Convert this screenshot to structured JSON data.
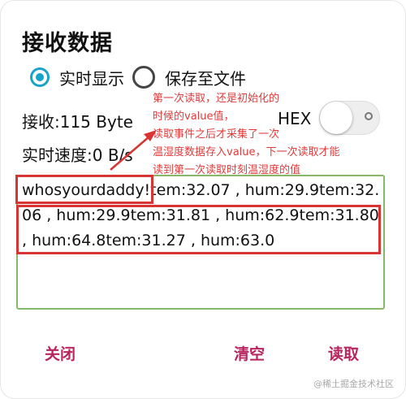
{
  "dialog": {
    "title": "接收数据"
  },
  "display_mode": {
    "realtime_label": "实时显示",
    "save_label": "保存至文件",
    "selected": "realtime"
  },
  "stats": {
    "received": "接收:115 Byte",
    "speed": "实时速度:0 B/s",
    "hex_label": "HEX",
    "hex_enabled": false
  },
  "received_data": "whosyourdaddy!tem:32.07 , hum:29.9tem:32.06 , hum:29.9tem:31.81 , hum:62.9tem:31.80 , hum:64.8tem:31.27 , hum:63.0",
  "annotation": {
    "lines": [
      "第一次读取，还是初始化的",
      "时候的value值，",
      "读取事件之后才采集了一次",
      "温湿度数据存入value，下一次读取才能",
      "读到第一次读取时刻温湿度的值"
    ],
    "color": "#e23a3a"
  },
  "buttons": {
    "close": "关闭",
    "clear": "清空",
    "read": "读取"
  },
  "colors": {
    "accent": "#1aa3c9",
    "button_text": "#b8245e",
    "data_border": "#86b86a",
    "highlight": "#d93434"
  },
  "watermark": "@稀土掘金技术社区"
}
